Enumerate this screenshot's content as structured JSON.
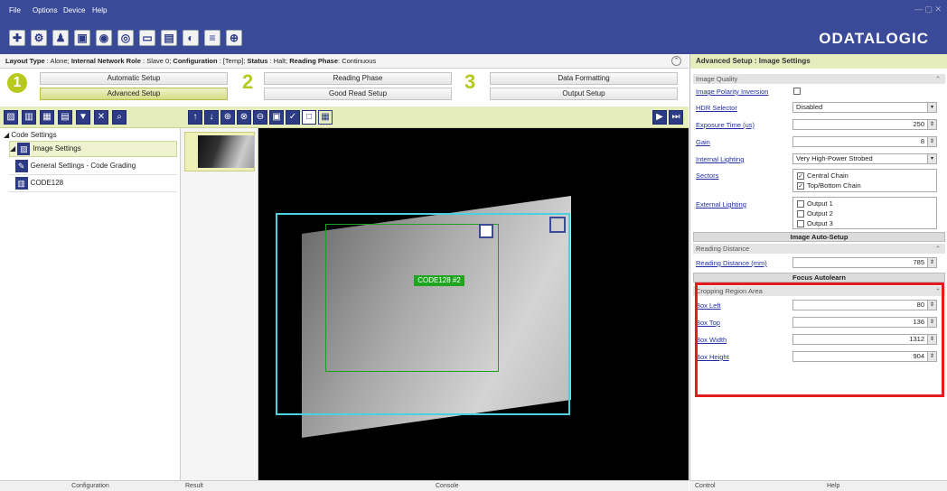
{
  "menu": [
    "File",
    "Options",
    "Device",
    "Help"
  ],
  "window_controls": "— ▢ ✕",
  "toolbar_icons": [
    "plus-icon",
    "gear-icon",
    "person-icon",
    "grid-icon",
    "camera-icon",
    "camera2-icon",
    "monitor-icon",
    "window-icon",
    "sensor-icon",
    "code-icon",
    "crosshair-icon"
  ],
  "logo": "ODATALOGIC",
  "status": {
    "layout_type_label": "Layout Type",
    "layout_type": "Alone",
    "role_label": "Internal Network Role",
    "role": "Slave 0",
    "config_label": "Configuration",
    "config": "[Temp]",
    "status_label": "Status",
    "status": "Halt",
    "phase_label": "Reading Phase",
    "phase": "Continuous"
  },
  "steps": {
    "n1": "1",
    "n2": "2",
    "n3": "3",
    "automatic_setup": "Automatic Setup",
    "advanced_setup": "Advanced Setup",
    "reading_phase": "Reading Phase",
    "good_read_setup": "Good Read Setup",
    "data_formatting": "Data Formatting",
    "output_setup": "Output Setup"
  },
  "tree": {
    "root": "Code Settings",
    "image_settings": "Image Settings",
    "general_settings": "General Settings - Code Grading",
    "code128": "CODE128"
  },
  "tabs": {
    "configuration": "Configuration",
    "result": "Result",
    "console": "Console",
    "control": "Control",
    "help": "Help"
  },
  "image": {
    "code_label": "CODE128 #2"
  },
  "panel": {
    "title": "Advanced Setup : Image Settings",
    "image_quality": "Image Quality",
    "polarity_label": "Image Polarity Inversion",
    "hdr_label": "HDR Selector",
    "hdr_value": "Disabled",
    "exposure_label": "Exposure Time (us)",
    "exposure_value": "250",
    "gain_label": "Gain",
    "gain_value": "8",
    "lighting_label": "Internal Lighting",
    "lighting_value": "Very High-Power Strobed",
    "sectors_label": "Sectors",
    "sector1": "Central Chain",
    "sector2": "Top/Bottom Chain",
    "ext_label": "External Lighting",
    "out1": "Output 1",
    "out2": "Output 2",
    "out3": "Output 3",
    "auto_setup": "Image Auto-Setup",
    "reading_distance": "Reading Distance",
    "rd_label": "Reading Distance (mm)",
    "rd_value": "785",
    "focus": "Focus Autolearn",
    "crop": "Cropping Region Area",
    "box_left_label": "Box Left",
    "box_left": "80",
    "box_top_label": "Box Top",
    "box_top": "136",
    "box_width_label": "Box Width",
    "box_width": "1312",
    "box_height_label": "Box Height",
    "box_height": "904"
  },
  "accent": "#b8c91d",
  "brand": "#3a4a98",
  "highlight": "#e61c1c"
}
